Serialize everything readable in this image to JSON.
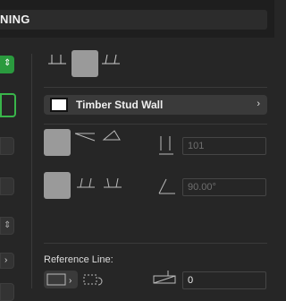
{
  "header": {
    "title": "NING"
  },
  "wall_button": {
    "label": "Timber Stud Wall",
    "arrow": "›"
  },
  "fields": {
    "height_value": "101",
    "angle_value": "90.00°",
    "offset_value": "0"
  },
  "reference_line": {
    "label": "Reference Line:"
  },
  "icons": {
    "left_stepper": "stepper-icon",
    "left_arrow": "chevron-right-icon"
  }
}
